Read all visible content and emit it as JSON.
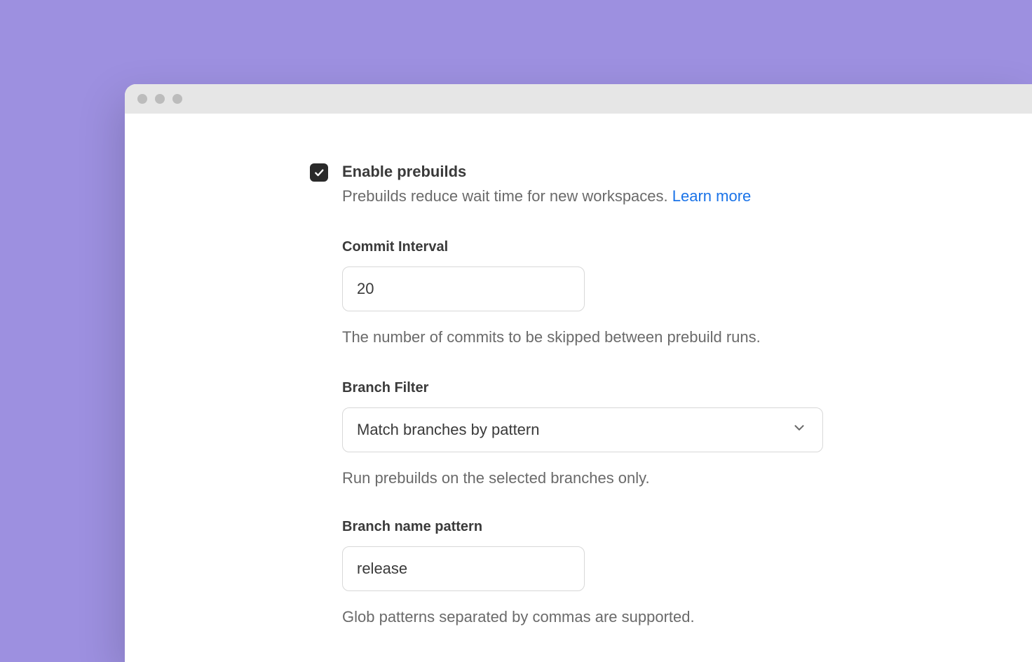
{
  "enable": {
    "title": "Enable prebuilds",
    "description": "Prebuilds reduce wait time for new workspaces. ",
    "learn_more": "Learn more",
    "checked": true
  },
  "commit_interval": {
    "label": "Commit Interval",
    "value": "20",
    "help": "The number of commits to be skipped between prebuild runs."
  },
  "branch_filter": {
    "label": "Branch Filter",
    "value": "Match branches by pattern",
    "help": "Run prebuilds on the selected branches only."
  },
  "branch_pattern": {
    "label": "Branch name pattern",
    "value": "release",
    "help": "Glob patterns separated by commas are supported."
  }
}
